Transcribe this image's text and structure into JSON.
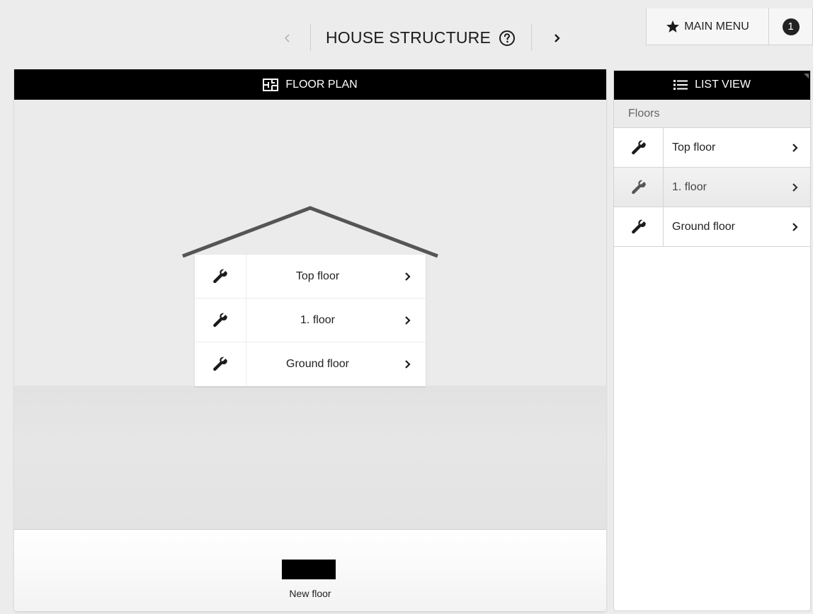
{
  "header": {
    "title": "HOUSE STRUCTURE",
    "prev_icon": "chevron-left-icon",
    "next_icon": "chevron-right-icon",
    "help_icon": "question-circle-icon",
    "main_menu_label": "MAIN MENU",
    "main_menu_icon": "star-icon",
    "notification_count": "1"
  },
  "floor_plan": {
    "title": "FLOOR PLAN",
    "icon": "floor-plan-icon",
    "floors": [
      {
        "label": "Top floor",
        "icon": "wrench-icon"
      },
      {
        "label": "1. floor",
        "icon": "wrench-icon"
      },
      {
        "label": "Ground floor",
        "icon": "wrench-icon"
      }
    ],
    "new_floor_label": "New floor"
  },
  "list_view": {
    "title": "LIST VIEW",
    "icon": "list-icon",
    "section_label": "Floors",
    "floors": [
      {
        "label": "Top floor",
        "icon": "wrench-icon",
        "active": false
      },
      {
        "label": "1. floor",
        "icon": "wrench-icon",
        "active": true
      },
      {
        "label": "Ground floor",
        "icon": "wrench-icon",
        "active": false
      }
    ]
  },
  "colors": {
    "background": "#ececec",
    "header_bar": "#000000",
    "roof": "#555555",
    "text": "#222222"
  }
}
